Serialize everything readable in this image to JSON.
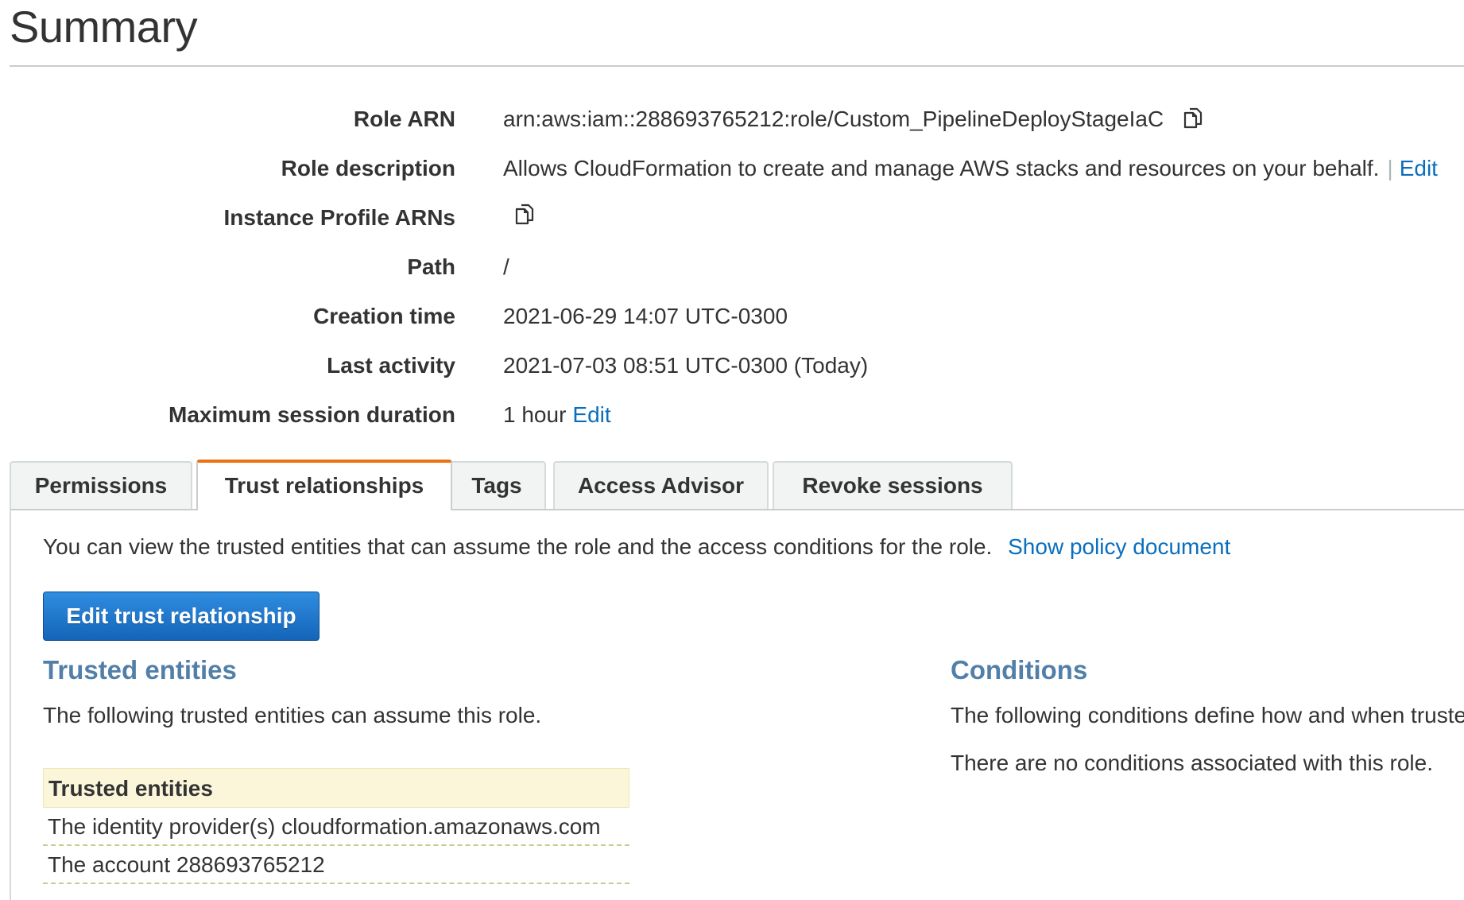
{
  "page": {
    "title": "Summary"
  },
  "summary": {
    "role_arn_label": "Role ARN",
    "role_arn_value": "arn:aws:iam::288693765212:role/Custom_PipelineDeployStageIaC",
    "role_description_label": "Role description",
    "role_description_value": "Allows CloudFormation to create and manage AWS stacks and resources on your behalf.",
    "role_description_separator": "|",
    "role_description_edit": "Edit",
    "instance_profile_label": "Instance Profile ARNs",
    "path_label": "Path",
    "path_value": "/",
    "creation_time_label": "Creation time",
    "creation_time_value": "2021-06-29 14:07 UTC-0300",
    "last_activity_label": "Last activity",
    "last_activity_value": "2021-07-03 08:51 UTC-0300 (Today)",
    "max_session_label": "Maximum session duration",
    "max_session_value": "1 hour",
    "max_session_edit": "Edit"
  },
  "tabs": [
    {
      "label": "Permissions",
      "active": false
    },
    {
      "label": "Trust relationships",
      "active": true
    },
    {
      "label": "Tags",
      "active": false
    },
    {
      "label": "Access Advisor",
      "active": false
    },
    {
      "label": "Revoke sessions",
      "active": false
    }
  ],
  "trust": {
    "intro_text": "You can view the trusted entities that can assume the role and the access conditions for the role.",
    "show_policy_link": "Show policy document",
    "edit_button": "Edit trust relationship",
    "trusted_entities_heading": "Trusted entities",
    "trusted_entities_desc": "The following trusted entities can assume this role.",
    "table_header": "Trusted entities",
    "entities": [
      "The identity provider(s) cloudformation.amazonaws.com",
      "The account 288693765212"
    ],
    "conditions_heading": "Conditions",
    "conditions_desc": "The following conditions define how and when truste",
    "conditions_none": "There are no conditions associated with this role."
  },
  "colors": {
    "link": "#0a6ebd",
    "active_tab_accent": "#ec7211",
    "section_heading": "#527fa8",
    "primary_button": "#1f77cc",
    "table_header_bg": "#fbf6d9"
  },
  "icons": {
    "copy": "copy-icon"
  }
}
